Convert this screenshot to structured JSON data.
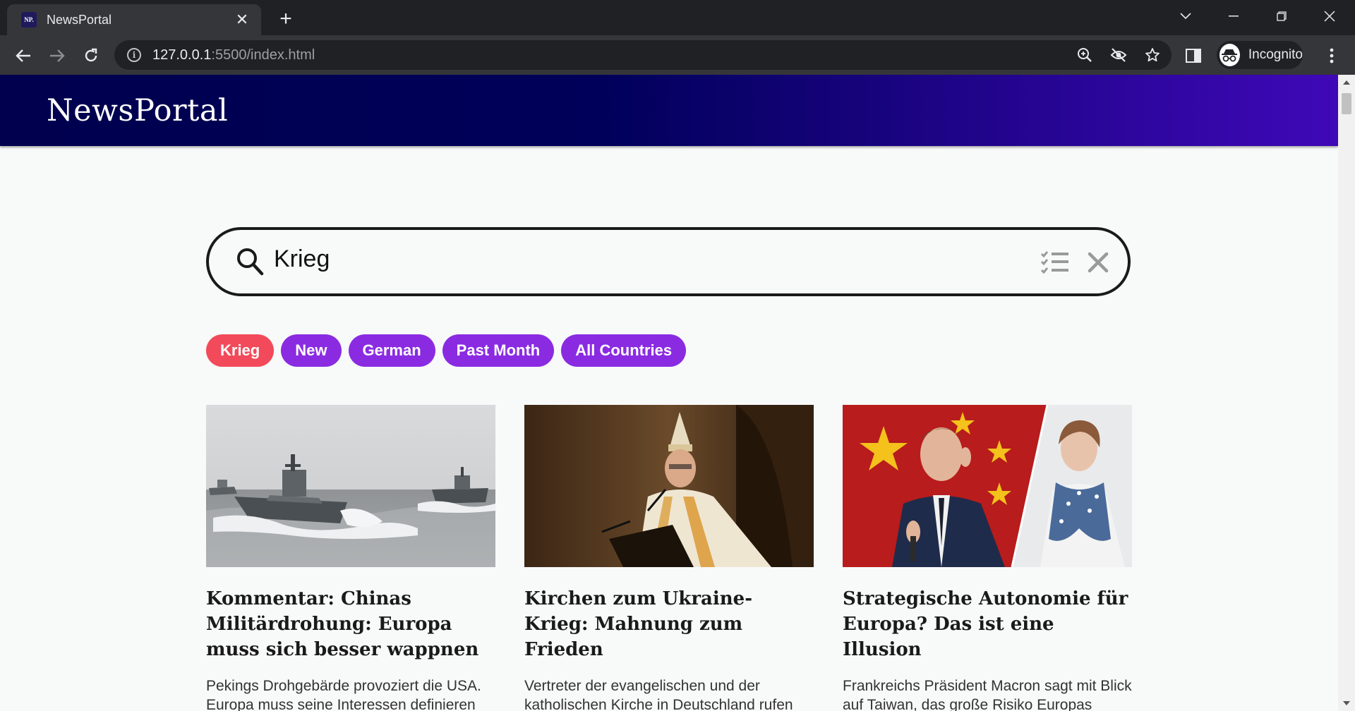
{
  "browser": {
    "tab_title": "NewsPortal",
    "favicon_text": "NP.",
    "url_host": "127.0.0.1",
    "url_rest": ":5500/index.html",
    "incognito_label": "Incognito"
  },
  "site": {
    "logo": "NewsPortal"
  },
  "search": {
    "query": "Krieg"
  },
  "chips": [
    {
      "label": "Krieg",
      "active": true
    },
    {
      "label": "New",
      "active": false
    },
    {
      "label": "German",
      "active": false
    },
    {
      "label": "Past Month",
      "active": false
    },
    {
      "label": "All Countries",
      "active": false
    }
  ],
  "articles": [
    {
      "title": "Kommentar: Chinas Militärdrohung: Europa muss sich besser wappnen",
      "desc": "Pekings Drohgebärde provoziert die USA. Europa muss seine Interessen definieren"
    },
    {
      "title": "Kirchen zum Ukraine-Krieg: Mahnung zum Frieden",
      "desc": "Vertreter der evangelischen und der katholischen Kirche in Deutschland rufen dazu auf, nach Wegen zu suchen, wie"
    },
    {
      "title": "Strategische Autonomie für Europa? Das ist eine Illusion",
      "desc": "Frankreichs Präsident Macron sagt mit Blick auf Taiwan, das große Risiko Europas bestehe darin, „in Krisen"
    }
  ],
  "colors": {
    "chip_active": "#f24a5a",
    "chip_filter": "#8a2be2",
    "header_start": "#00004e",
    "header_end": "#3f08b8"
  }
}
